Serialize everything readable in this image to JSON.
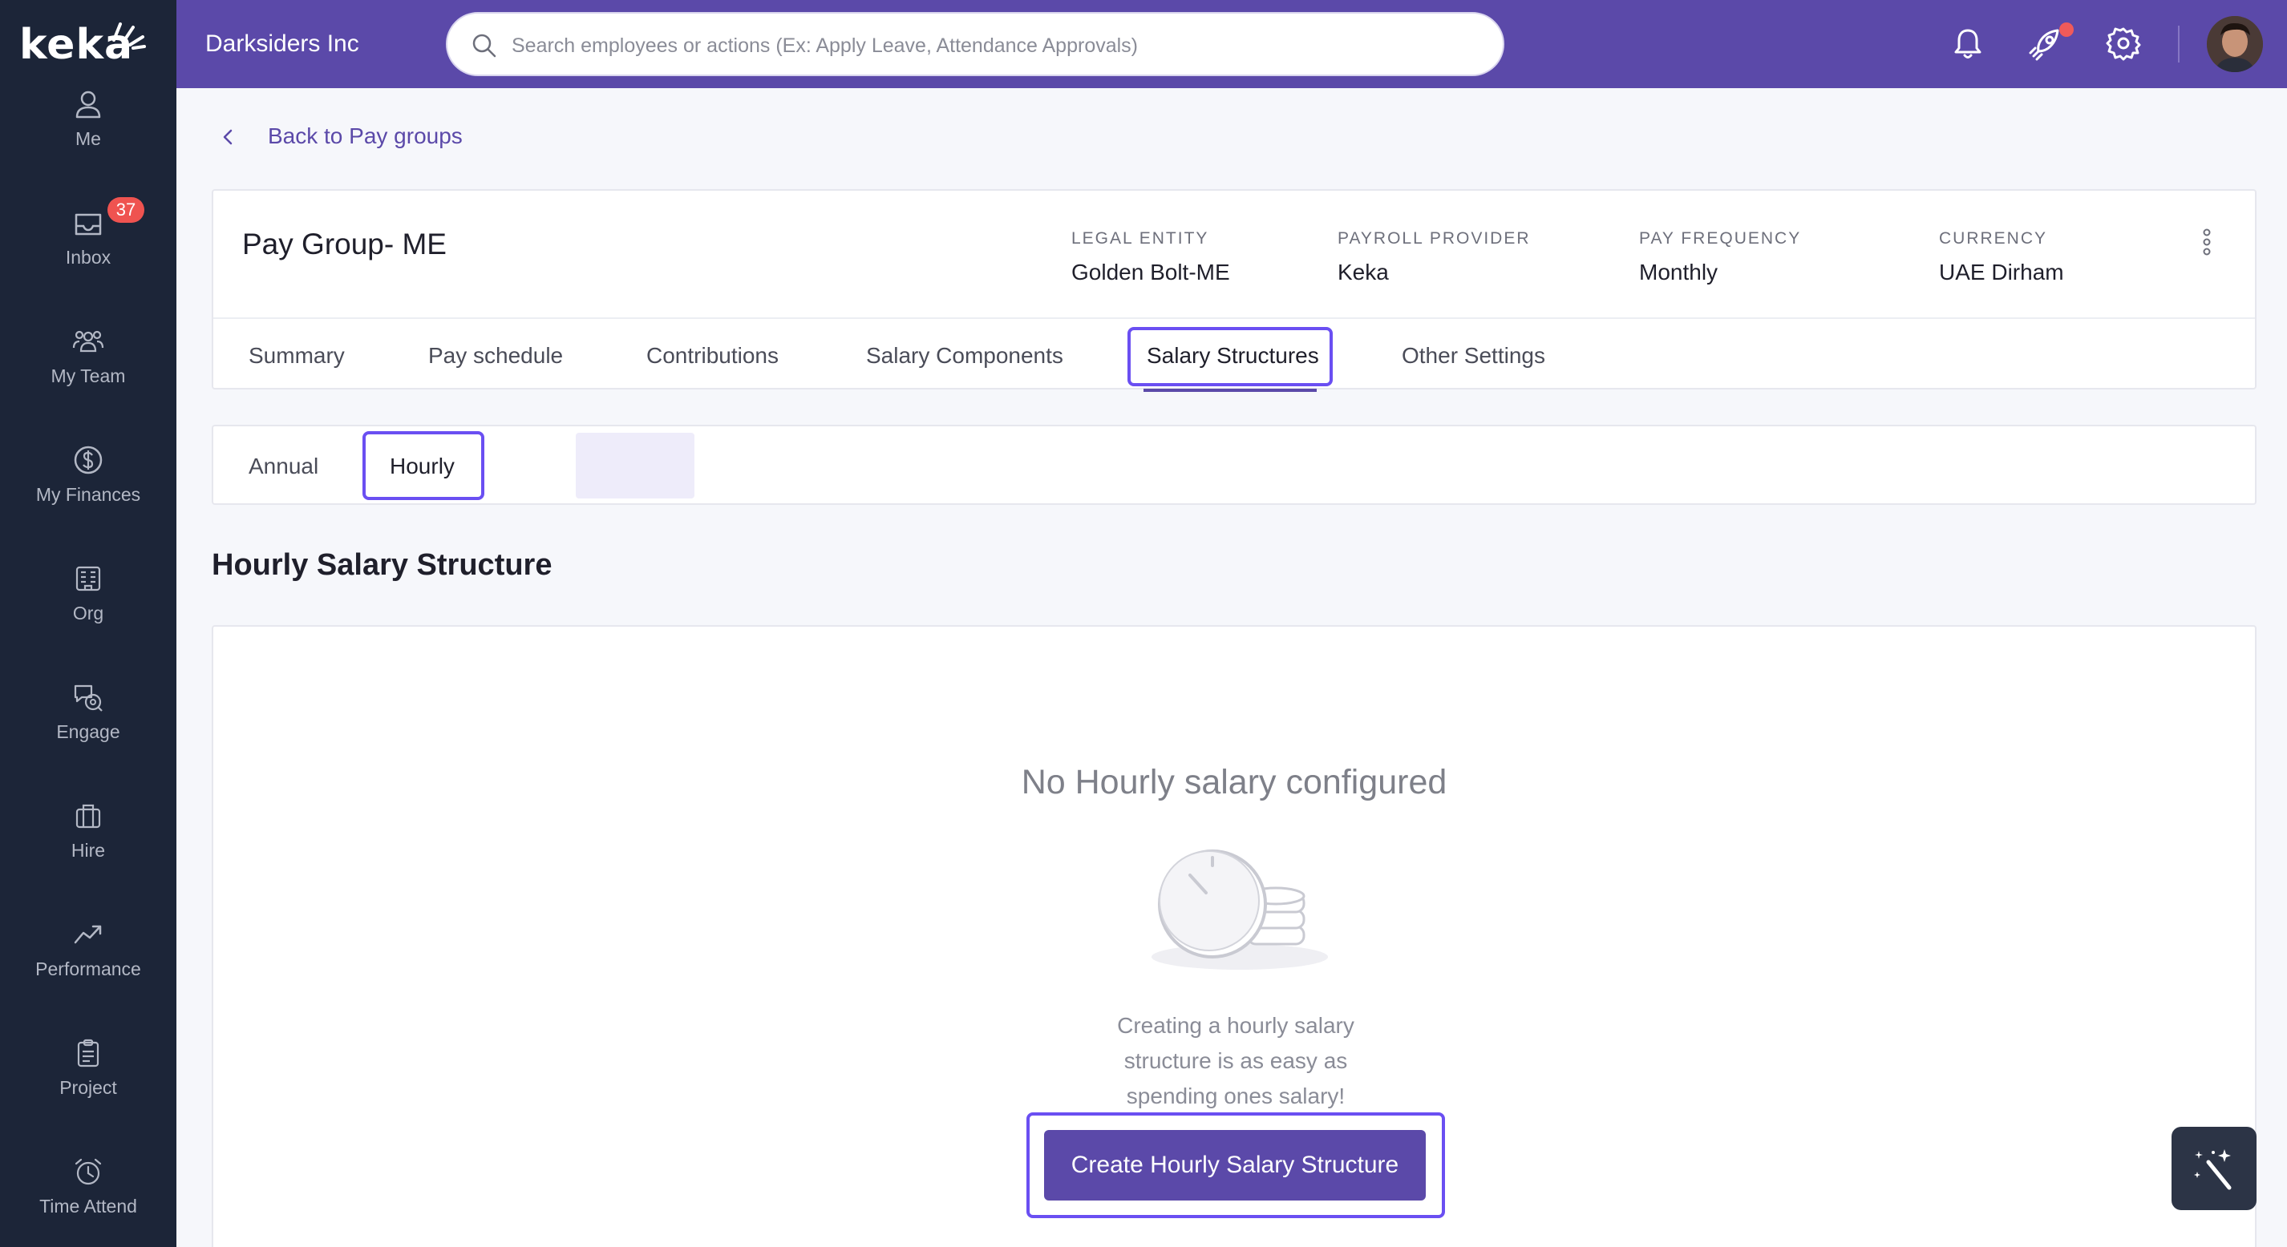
{
  "brand": {
    "logo_text": "keka",
    "company": "Darksiders Inc"
  },
  "search": {
    "placeholder": "Search employees or actions (Ex: Apply Leave, Attendance Approvals)"
  },
  "sidebar": {
    "items": [
      {
        "label": "Me",
        "icon": "user-icon"
      },
      {
        "label": "Inbox",
        "icon": "inbox-icon",
        "badge": "37"
      },
      {
        "label": "My Team",
        "icon": "team-icon"
      },
      {
        "label": "My Finances",
        "icon": "dollar-icon"
      },
      {
        "label": "Org",
        "icon": "org-icon"
      },
      {
        "label": "Engage",
        "icon": "engage-icon"
      },
      {
        "label": "Hire",
        "icon": "briefcase-icon"
      },
      {
        "label": "Performance",
        "icon": "trend-icon"
      },
      {
        "label": "Project",
        "icon": "clipboard-icon"
      },
      {
        "label": "Time Attend",
        "icon": "alarm-clock-icon"
      }
    ]
  },
  "back": {
    "label": "Back to Pay groups"
  },
  "paygroup": {
    "title": "Pay Group- ME",
    "meta": [
      {
        "label": "LEGAL ENTITY",
        "value": "Golden Bolt-ME"
      },
      {
        "label": "PAYROLL PROVIDER",
        "value": "Keka"
      },
      {
        "label": "PAY FREQUENCY",
        "value": "Monthly"
      },
      {
        "label": "CURRENCY",
        "value": "UAE Dirham"
      }
    ],
    "tabs": [
      "Summary",
      "Pay schedule",
      "Contributions",
      "Salary Components",
      "Salary Structures",
      "Other Settings"
    ],
    "active_tab": "Salary Structures"
  },
  "subtabs": {
    "items": [
      "Annual",
      "Hourly"
    ],
    "active": "Hourly"
  },
  "section": {
    "title": "Hourly Salary Structure"
  },
  "empty": {
    "title": "No Hourly salary configured",
    "desc": "Creating a hourly salary structure is as easy as spending ones salary!",
    "button": "Create Hourly Salary Structure"
  },
  "colors": {
    "brand": "#5b49a9",
    "sidebar": "#1c2538",
    "highlight": "#6a4ff2",
    "badge": "#ef5350"
  }
}
